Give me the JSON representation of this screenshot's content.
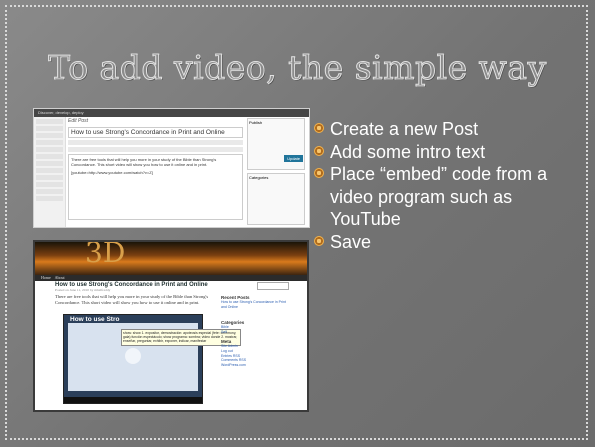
{
  "slide": {
    "title": "To add video, the simple way",
    "bullets": [
      "Create a new Post",
      "Add some intro text",
      "Place “embed” code from a video program such as YouTube",
      "Save"
    ]
  },
  "screenshot_editor": {
    "site_name": "Discover, develop, deploy",
    "page_heading": "Edit Post",
    "post_title": "How to use Strong's Concordance in Print and Online",
    "body_text": "There are free tools that will help you more in your study of the Bible than Strong's Concordance. This short video will show you how to use it online and in print.",
    "embed_text": "[youtube=http://www.youtube.com/watch?v=Z]",
    "publish_button": "Update",
    "panel_publish": "Publish",
    "panel_categories": "Categories"
  },
  "screenshot_blog": {
    "logo_text": "3D",
    "nav_items": [
      "Home",
      "About"
    ],
    "post_title": "How to use Strong's Concordance in Print and Online",
    "post_meta": "Posted on June 11, 2010 by mhzlfreddy",
    "post_text": "There are free tools that will help you more in your study of the Bible than Strong's Concordance. This short video will show you how to use it online and in print.",
    "video_title": "How to use Stro",
    "tooltip_text": "show: show 1. expositor, demostración: apoteosis especial (fete: ceremony, gala) función espectáculo; show programa: sombra; video donde 2. mostrar, enseñar, preguntar, exhibir, exponer, indicar, manifestar",
    "search_button": "Search",
    "sidebar": {
      "recent_posts_heading": "Recent Posts",
      "recent_posts": [
        "How to use Strong's Concordance in Print and Online"
      ],
      "categories_heading": "Categories",
      "categories": [
        "Bible",
        "Self"
      ],
      "meta_heading": "Meta",
      "meta_links": [
        "Site Admin",
        "Log out",
        "Entries RSS",
        "Comments RSS",
        "WordPress.com"
      ]
    }
  }
}
